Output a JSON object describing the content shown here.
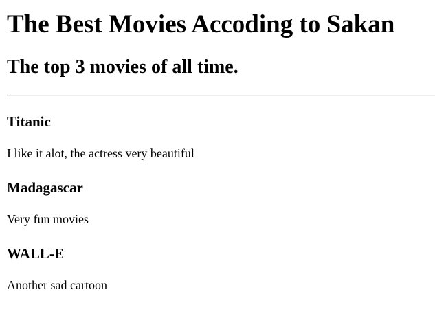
{
  "page": {
    "title": "The Best Movies Accoding to Sakan",
    "subtitle": "The top 3 movies of all time."
  },
  "movies": [
    {
      "name": "Titanic",
      "review": "I like it alot, the actress very beautiful"
    },
    {
      "name": "Madagascar",
      "review": "Very fun movies"
    },
    {
      "name": "WALL-E",
      "review": "Another sad cartoon"
    }
  ]
}
